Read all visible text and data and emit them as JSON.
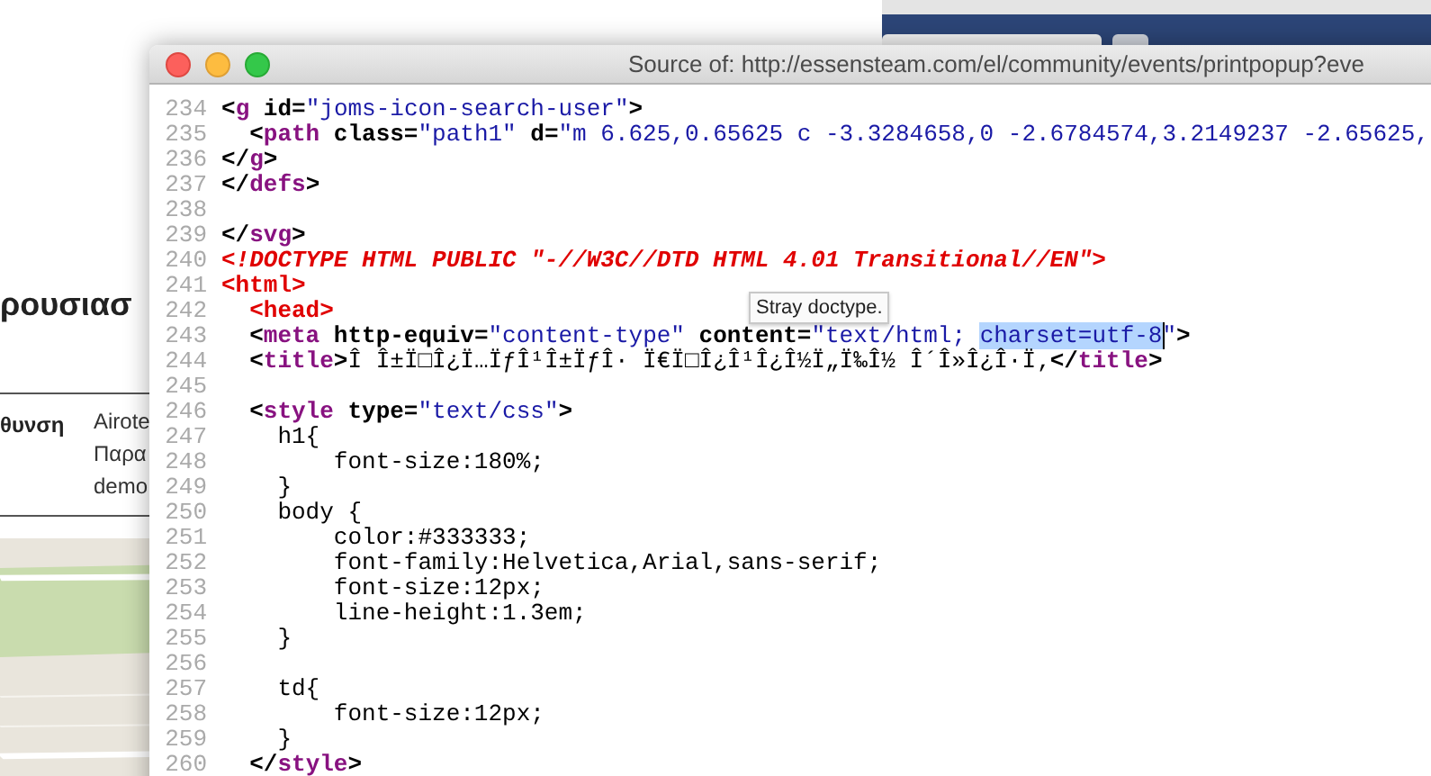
{
  "background_page": {
    "heading": "ρουσιασ",
    "details": {
      "label": "θυνση",
      "lines": [
        "Airote",
        "Παρα",
        "demo"
      ]
    }
  },
  "back_window": {
    "tabs": [
      {
        "selected": true
      },
      {
        "selected": false
      }
    ]
  },
  "window": {
    "title": "Source of: http://essensteam.com/el/community/events/printpopup?eve",
    "lines": [
      {
        "number": "234",
        "tokens": [
          {
            "kind": "punct",
            "text": "<"
          },
          {
            "kind": "tag",
            "text": "g"
          },
          {
            "kind": "attr",
            "text": " id="
          },
          {
            "kind": "value",
            "text": "\"joms-icon-search-user\""
          },
          {
            "kind": "punct",
            "text": ">"
          }
        ]
      },
      {
        "number": "235",
        "tokens": [
          {
            "kind": "punct",
            "text": "  <"
          },
          {
            "kind": "tag",
            "text": "path"
          },
          {
            "kind": "attr",
            "text": " class="
          },
          {
            "kind": "value",
            "text": "\"path1\""
          },
          {
            "kind": "attr",
            "text": " d="
          },
          {
            "kind": "value",
            "text": "\"m 6.625,0.65625 c -3.3284658,0 -2.6784574,3.2149237 -2.65625,"
          }
        ]
      },
      {
        "number": "236",
        "tokens": [
          {
            "kind": "punct",
            "text": "</"
          },
          {
            "kind": "tag",
            "text": "g"
          },
          {
            "kind": "punct",
            "text": ">"
          }
        ]
      },
      {
        "number": "237",
        "tokens": [
          {
            "kind": "punct",
            "text": "</"
          },
          {
            "kind": "tag",
            "text": "defs"
          },
          {
            "kind": "punct",
            "text": ">"
          }
        ]
      },
      {
        "number": "238"
      },
      {
        "number": "239",
        "tokens": [
          {
            "kind": "punct",
            "text": "</"
          },
          {
            "kind": "tag",
            "text": "svg"
          },
          {
            "kind": "punct",
            "text": ">"
          }
        ]
      },
      {
        "number": "240",
        "tokens": [
          {
            "kind": "doctype",
            "text": "<!DOCTYPE HTML PUBLIC \"-//W3C//DTD HTML 4.01 Transitional//EN\">"
          }
        ]
      },
      {
        "number": "241",
        "tokens": [
          {
            "kind": "error",
            "text": "<html>"
          }
        ]
      },
      {
        "number": "242",
        "tokens": [
          {
            "kind": "error",
            "text": "  <head>"
          }
        ]
      },
      {
        "number": "243",
        "tokens": [
          {
            "kind": "punct",
            "text": "  <"
          },
          {
            "kind": "tag",
            "text": "meta"
          },
          {
            "kind": "attr",
            "text": " http-equiv="
          },
          {
            "kind": "value",
            "text": "\"content-type\""
          },
          {
            "kind": "attr",
            "text": " content="
          },
          {
            "kind": "value",
            "text": "\"text/html; "
          },
          {
            "kind": "selection",
            "text": "charset=utf-8"
          },
          {
            "kind": "value",
            "text": "\""
          },
          {
            "kind": "punct",
            "text": ">"
          }
        ]
      },
      {
        "number": "244",
        "tokens": [
          {
            "kind": "punct",
            "text": "  <"
          },
          {
            "kind": "tag",
            "text": "title"
          },
          {
            "kind": "punct",
            "text": ">"
          },
          {
            "kind": "text",
            "text": "Î Î±Ï□Î¿Ï…ÏƒÎ¹Î±ÏƒÎ· Ï€Ï□Î¿Î¹Î¿Î½Ï„Ï‰Î½ Î´Î»Î¿Î·Ï‚"
          },
          {
            "kind": "punct",
            "text": "</"
          },
          {
            "kind": "tag",
            "text": "title"
          },
          {
            "kind": "punct",
            "text": ">"
          }
        ]
      },
      {
        "number": "245"
      },
      {
        "number": "246",
        "tokens": [
          {
            "kind": "punct",
            "text": "  <"
          },
          {
            "kind": "tag",
            "text": "style"
          },
          {
            "kind": "attr",
            "text": " type="
          },
          {
            "kind": "value",
            "text": "\"text/css\""
          },
          {
            "kind": "punct",
            "text": ">"
          }
        ]
      },
      {
        "number": "247",
        "tokens": [
          {
            "kind": "text",
            "text": "    h1{"
          }
        ]
      },
      {
        "number": "248",
        "tokens": [
          {
            "kind": "text",
            "text": "        font-size:180%;"
          }
        ]
      },
      {
        "number": "249",
        "tokens": [
          {
            "kind": "text",
            "text": "    }"
          }
        ]
      },
      {
        "number": "250",
        "tokens": [
          {
            "kind": "text",
            "text": "    body {"
          }
        ]
      },
      {
        "number": "251",
        "tokens": [
          {
            "kind": "text",
            "text": "        color:#333333;"
          }
        ]
      },
      {
        "number": "252",
        "tokens": [
          {
            "kind": "text",
            "text": "        font-family:Helvetica,Arial,sans-serif;"
          }
        ]
      },
      {
        "number": "253",
        "tokens": [
          {
            "kind": "text",
            "text": "        font-size:12px;"
          }
        ]
      },
      {
        "number": "254",
        "tokens": [
          {
            "kind": "text",
            "text": "        line-height:1.3em;"
          }
        ]
      },
      {
        "number": "255",
        "tokens": [
          {
            "kind": "text",
            "text": "    }"
          }
        ]
      },
      {
        "number": "256"
      },
      {
        "number": "257",
        "tokens": [
          {
            "kind": "text",
            "text": "    td{"
          }
        ]
      },
      {
        "number": "258",
        "tokens": [
          {
            "kind": "text",
            "text": "        font-size:12px;"
          }
        ]
      },
      {
        "number": "259",
        "tokens": [
          {
            "kind": "text",
            "text": "    }"
          }
        ]
      },
      {
        "number": "260",
        "tokens": [
          {
            "kind": "punct",
            "text": "  </"
          },
          {
            "kind": "tag",
            "text": "style"
          },
          {
            "kind": "punct",
            "text": ">"
          }
        ]
      }
    ],
    "tooltip": "Stray doctype."
  }
}
